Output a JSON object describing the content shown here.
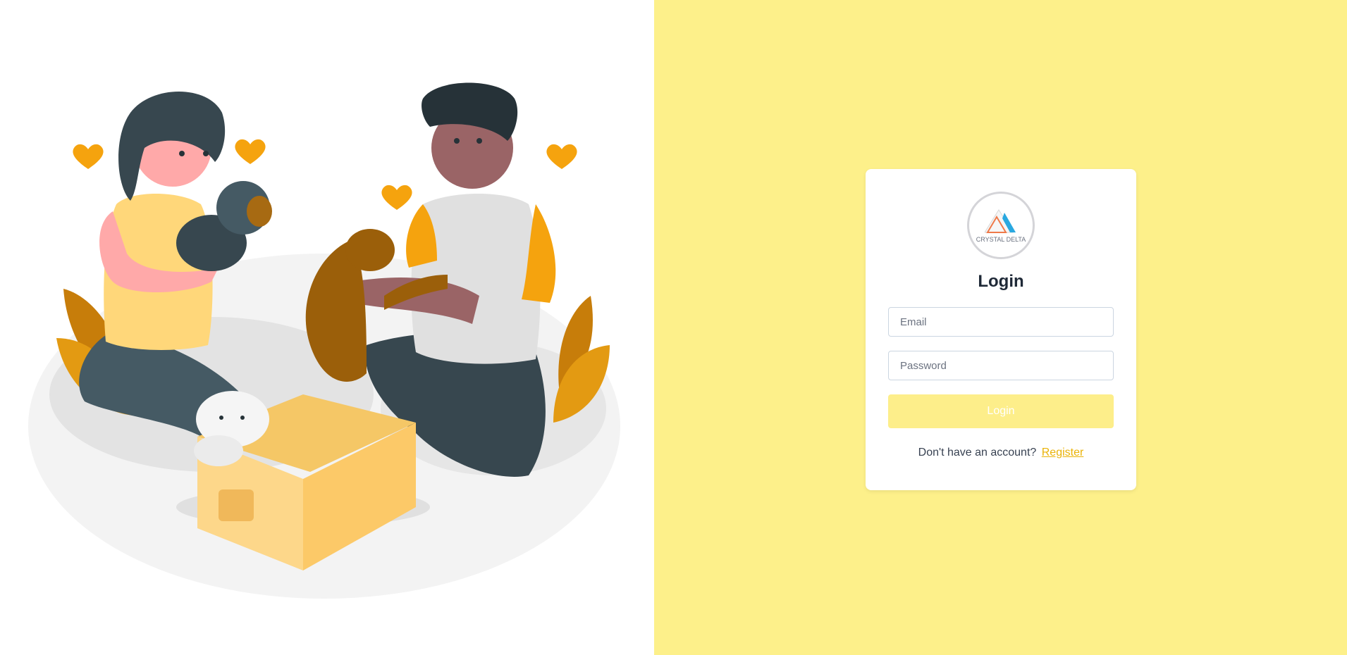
{
  "illustration": {
    "icon": "people-with-pets-illustration",
    "colors": {
      "accent": "#f5a30e",
      "platform": "#f2f2f2"
    }
  },
  "logo": {
    "text": "CRYSTAL DELTA",
    "icon": "triangle-logo-icon"
  },
  "login": {
    "title": "Login",
    "email_placeholder": "Email",
    "email_value": "",
    "password_placeholder": "Password",
    "password_value": "",
    "button_label": "Login",
    "register_prompt": "Don't have an account?",
    "register_link": "Register"
  },
  "colors": {
    "panel_background": "#fdf08a",
    "button_background": "#fdee8a",
    "link": "#eab308"
  }
}
